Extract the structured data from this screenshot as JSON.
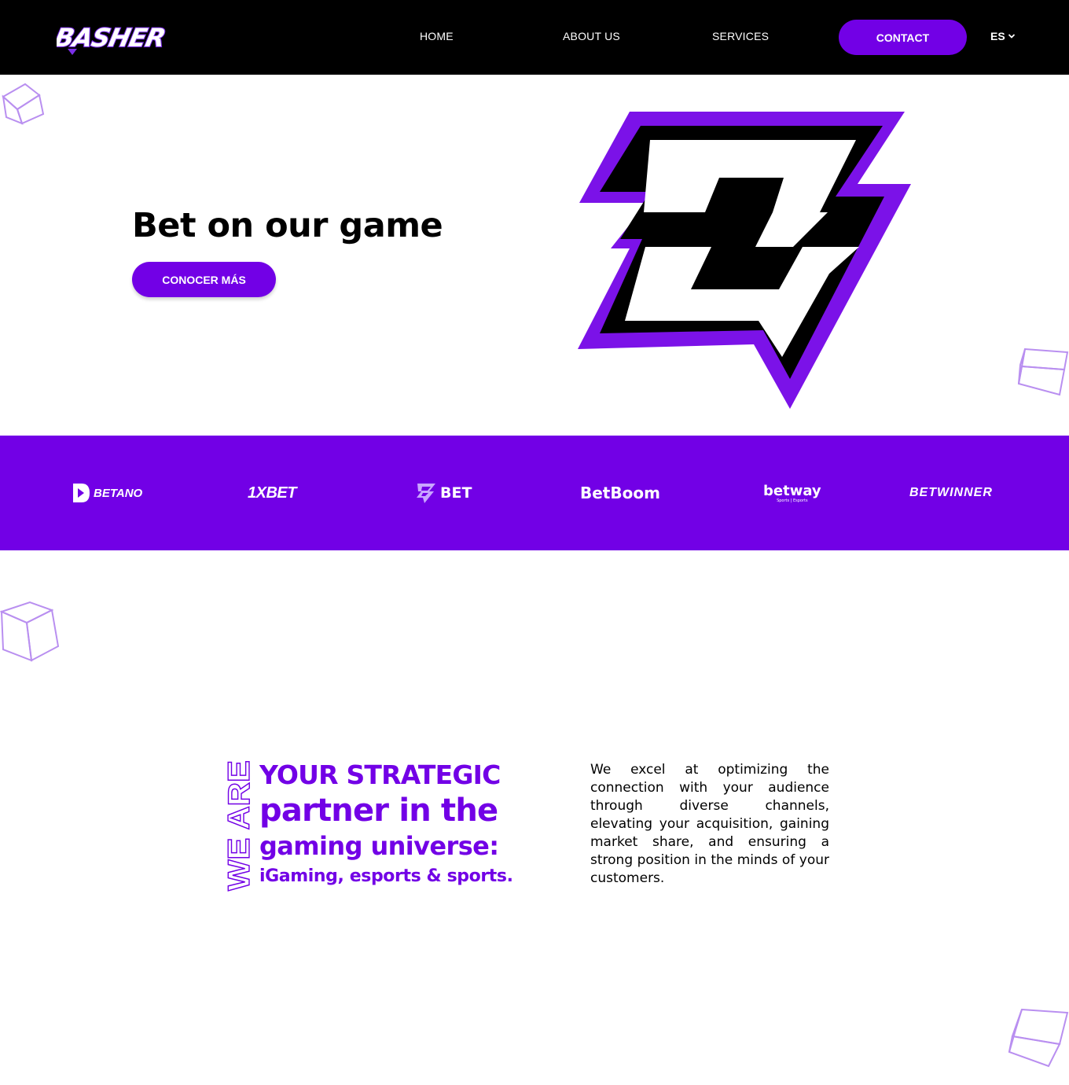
{
  "header": {
    "logo_text": "BASHER",
    "nav": {
      "home": "HOME",
      "about": "ABOUT US",
      "services": "SERVICES",
      "contact": "CONTACT"
    },
    "language": "ES"
  },
  "hero": {
    "title": "Bet on our game",
    "button_label": "CONOCER MÁS"
  },
  "partners": [
    {
      "name": "BETANO"
    },
    {
      "name": "1XBET"
    },
    {
      "name": "BET"
    },
    {
      "name": "BetBoom"
    },
    {
      "name": "betway",
      "tagline": "Sports | Esports"
    },
    {
      "name": "BETWINNER"
    }
  ],
  "about": {
    "vertical_label": "WE ARE",
    "headline_1": "YOUR STRATEGIC",
    "headline_2": "partner in the",
    "headline_3": "gaming universe:",
    "headline_4": "iGaming, esports & sports.",
    "description": "We excel at optimizing the connection with your audience through diverse channels, elevating your acquisition, gaining market share, and ensuring a strong position in the minds of your customers."
  },
  "colors": {
    "brand_purple": "#7200e6",
    "header_bg": "#000000",
    "cube_stroke": "#b98ff0"
  },
  "icons": [
    "chevron-down-icon",
    "cube-icon",
    "basher-b-logo"
  ]
}
